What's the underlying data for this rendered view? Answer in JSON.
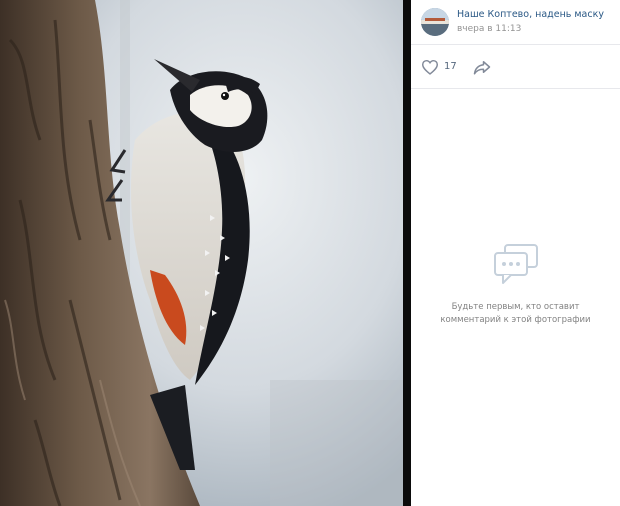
{
  "photo": {
    "subject": "woodpecker-on-tree-trunk"
  },
  "post": {
    "author": "Наше Коптево, надень маску",
    "time": "вчера в 11:13"
  },
  "actions": {
    "like_count": "17",
    "like_icon": "heart-outline-icon",
    "share_icon": "share-arrow-icon"
  },
  "comments": {
    "empty_icon": "comments-bubble-icon",
    "empty_line1": "Будьте первым, кто оставит",
    "empty_line2": "комментарий к этой фотографии"
  },
  "colors": {
    "link": "#2a5885",
    "muted": "#939393",
    "icon": "#828a99",
    "divider": "#e7e8ec"
  }
}
